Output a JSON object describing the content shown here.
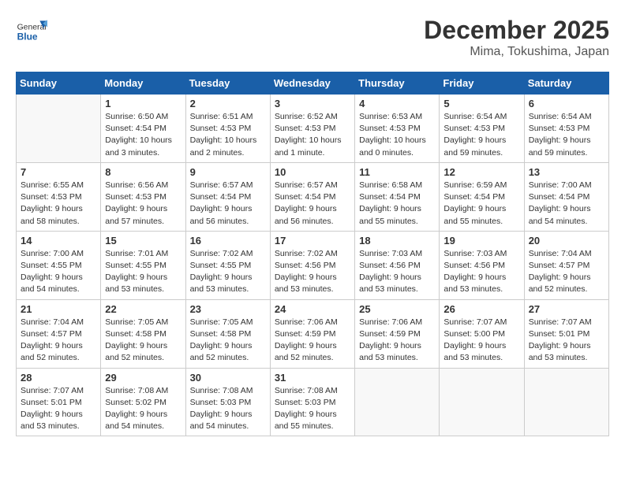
{
  "header": {
    "logo_general": "General",
    "logo_blue": "Blue",
    "month_title": "December 2025",
    "location": "Mima, Tokushima, Japan"
  },
  "days_of_week": [
    "Sunday",
    "Monday",
    "Tuesday",
    "Wednesday",
    "Thursday",
    "Friday",
    "Saturday"
  ],
  "weeks": [
    [
      {
        "day": "",
        "empty": true
      },
      {
        "day": "1",
        "sunrise": "Sunrise: 6:50 AM",
        "sunset": "Sunset: 4:54 PM",
        "daylight": "Daylight: 10 hours and 3 minutes."
      },
      {
        "day": "2",
        "sunrise": "Sunrise: 6:51 AM",
        "sunset": "Sunset: 4:53 PM",
        "daylight": "Daylight: 10 hours and 2 minutes."
      },
      {
        "day": "3",
        "sunrise": "Sunrise: 6:52 AM",
        "sunset": "Sunset: 4:53 PM",
        "daylight": "Daylight: 10 hours and 1 minute."
      },
      {
        "day": "4",
        "sunrise": "Sunrise: 6:53 AM",
        "sunset": "Sunset: 4:53 PM",
        "daylight": "Daylight: 10 hours and 0 minutes."
      },
      {
        "day": "5",
        "sunrise": "Sunrise: 6:54 AM",
        "sunset": "Sunset: 4:53 PM",
        "daylight": "Daylight: 9 hours and 59 minutes."
      },
      {
        "day": "6",
        "sunrise": "Sunrise: 6:54 AM",
        "sunset": "Sunset: 4:53 PM",
        "daylight": "Daylight: 9 hours and 59 minutes."
      }
    ],
    [
      {
        "day": "7",
        "sunrise": "Sunrise: 6:55 AM",
        "sunset": "Sunset: 4:53 PM",
        "daylight": "Daylight: 9 hours and 58 minutes."
      },
      {
        "day": "8",
        "sunrise": "Sunrise: 6:56 AM",
        "sunset": "Sunset: 4:53 PM",
        "daylight": "Daylight: 9 hours and 57 minutes."
      },
      {
        "day": "9",
        "sunrise": "Sunrise: 6:57 AM",
        "sunset": "Sunset: 4:54 PM",
        "daylight": "Daylight: 9 hours and 56 minutes."
      },
      {
        "day": "10",
        "sunrise": "Sunrise: 6:57 AM",
        "sunset": "Sunset: 4:54 PM",
        "daylight": "Daylight: 9 hours and 56 minutes."
      },
      {
        "day": "11",
        "sunrise": "Sunrise: 6:58 AM",
        "sunset": "Sunset: 4:54 PM",
        "daylight": "Daylight: 9 hours and 55 minutes."
      },
      {
        "day": "12",
        "sunrise": "Sunrise: 6:59 AM",
        "sunset": "Sunset: 4:54 PM",
        "daylight": "Daylight: 9 hours and 55 minutes."
      },
      {
        "day": "13",
        "sunrise": "Sunrise: 7:00 AM",
        "sunset": "Sunset: 4:54 PM",
        "daylight": "Daylight: 9 hours and 54 minutes."
      }
    ],
    [
      {
        "day": "14",
        "sunrise": "Sunrise: 7:00 AM",
        "sunset": "Sunset: 4:55 PM",
        "daylight": "Daylight: 9 hours and 54 minutes."
      },
      {
        "day": "15",
        "sunrise": "Sunrise: 7:01 AM",
        "sunset": "Sunset: 4:55 PM",
        "daylight": "Daylight: 9 hours and 53 minutes."
      },
      {
        "day": "16",
        "sunrise": "Sunrise: 7:02 AM",
        "sunset": "Sunset: 4:55 PM",
        "daylight": "Daylight: 9 hours and 53 minutes."
      },
      {
        "day": "17",
        "sunrise": "Sunrise: 7:02 AM",
        "sunset": "Sunset: 4:56 PM",
        "daylight": "Daylight: 9 hours and 53 minutes."
      },
      {
        "day": "18",
        "sunrise": "Sunrise: 7:03 AM",
        "sunset": "Sunset: 4:56 PM",
        "daylight": "Daylight: 9 hours and 53 minutes."
      },
      {
        "day": "19",
        "sunrise": "Sunrise: 7:03 AM",
        "sunset": "Sunset: 4:56 PM",
        "daylight": "Daylight: 9 hours and 53 minutes."
      },
      {
        "day": "20",
        "sunrise": "Sunrise: 7:04 AM",
        "sunset": "Sunset: 4:57 PM",
        "daylight": "Daylight: 9 hours and 52 minutes."
      }
    ],
    [
      {
        "day": "21",
        "sunrise": "Sunrise: 7:04 AM",
        "sunset": "Sunset: 4:57 PM",
        "daylight": "Daylight: 9 hours and 52 minutes."
      },
      {
        "day": "22",
        "sunrise": "Sunrise: 7:05 AM",
        "sunset": "Sunset: 4:58 PM",
        "daylight": "Daylight: 9 hours and 52 minutes."
      },
      {
        "day": "23",
        "sunrise": "Sunrise: 7:05 AM",
        "sunset": "Sunset: 4:58 PM",
        "daylight": "Daylight: 9 hours and 52 minutes."
      },
      {
        "day": "24",
        "sunrise": "Sunrise: 7:06 AM",
        "sunset": "Sunset: 4:59 PM",
        "daylight": "Daylight: 9 hours and 52 minutes."
      },
      {
        "day": "25",
        "sunrise": "Sunrise: 7:06 AM",
        "sunset": "Sunset: 4:59 PM",
        "daylight": "Daylight: 9 hours and 53 minutes."
      },
      {
        "day": "26",
        "sunrise": "Sunrise: 7:07 AM",
        "sunset": "Sunset: 5:00 PM",
        "daylight": "Daylight: 9 hours and 53 minutes."
      },
      {
        "day": "27",
        "sunrise": "Sunrise: 7:07 AM",
        "sunset": "Sunset: 5:01 PM",
        "daylight": "Daylight: 9 hours and 53 minutes."
      }
    ],
    [
      {
        "day": "28",
        "sunrise": "Sunrise: 7:07 AM",
        "sunset": "Sunset: 5:01 PM",
        "daylight": "Daylight: 9 hours and 53 minutes."
      },
      {
        "day": "29",
        "sunrise": "Sunrise: 7:08 AM",
        "sunset": "Sunset: 5:02 PM",
        "daylight": "Daylight: 9 hours and 54 minutes."
      },
      {
        "day": "30",
        "sunrise": "Sunrise: 7:08 AM",
        "sunset": "Sunset: 5:03 PM",
        "daylight": "Daylight: 9 hours and 54 minutes."
      },
      {
        "day": "31",
        "sunrise": "Sunrise: 7:08 AM",
        "sunset": "Sunset: 5:03 PM",
        "daylight": "Daylight: 9 hours and 55 minutes."
      },
      {
        "day": "",
        "empty": true
      },
      {
        "day": "",
        "empty": true
      },
      {
        "day": "",
        "empty": true
      }
    ]
  ]
}
